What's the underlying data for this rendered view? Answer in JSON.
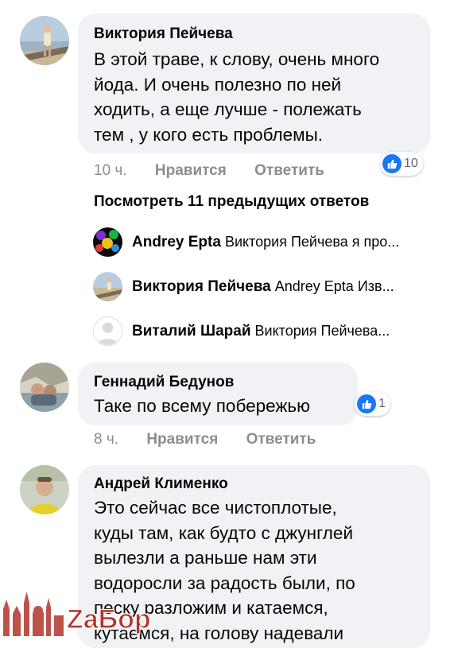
{
  "comments": [
    {
      "author": "Виктория Пейчева",
      "text": "В этой траве, к слову, очень много\nйода. И очень полезно по ней\nходить, а еще лучше - полежать\nтем , у кого есть проблемы.",
      "time": "10 ч.",
      "like_label": "Нравится",
      "reply_label": "Ответить",
      "reaction_count": "10"
    },
    {
      "author": "Геннадий Бедунов",
      "text": "Таке по всему побережью",
      "time": "8 ч.",
      "like_label": "Нравится",
      "reply_label": "Ответить",
      "reaction_count": "1"
    },
    {
      "author": "Андрей Клименко",
      "text": "Это сейчас все чистоплотые,\nкуды там, как будто с джунглей\nвылезли а раньше нам эти\nводоросли за радость были, по\nпеску разложим и катаемся,\nкутаемся, на голову надевали"
    }
  ],
  "previous_replies_link": "Посмотреть 11 предыдущих ответов",
  "replies": [
    {
      "name": "Andrey Epta",
      "text": "Виктория Пейчева я про..."
    },
    {
      "name": "Виктория Пейчева",
      "text": "Andrey Epta Изв..."
    },
    {
      "name": "Виталий Шарай",
      "text": "Виктория Пейчева..."
    }
  ],
  "watermark": {
    "logo_text": "ZaБор"
  },
  "colors": {
    "bubble": "#f0f2f5",
    "meta": "#8a8d91",
    "like_blue": "#1877f2"
  }
}
